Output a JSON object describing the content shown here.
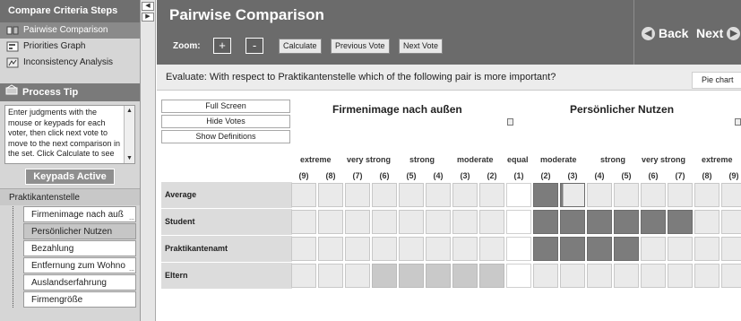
{
  "sidebar": {
    "header": "Compare Criteria Steps",
    "steps": [
      {
        "label": "Pairwise Comparison",
        "icon": "compare-icon",
        "active": true
      },
      {
        "label": "Priorities Graph",
        "icon": "graph-icon",
        "active": false
      },
      {
        "label": "Inconsistency Analysis",
        "icon": "inconsistency-icon",
        "active": false
      }
    ],
    "tip_header": "Process Tip",
    "tip_text": "Enter judgments with the mouse or keypads for each voter, then click next vote to move to the next comparison in the set. Click Calculate to see",
    "keypads_label": "Keypads Active",
    "criteria_root": "Praktikantenstelle",
    "criteria": [
      {
        "label": "Firmenimage nach auß",
        "selected": false,
        "truncated": true
      },
      {
        "label": "Persönlicher Nutzen",
        "selected": true,
        "truncated": false
      },
      {
        "label": "Bezahlung",
        "selected": false,
        "truncated": false
      },
      {
        "label": "Entfernung zum Wohno",
        "selected": false,
        "truncated": true
      },
      {
        "label": "Auslandserfahrung",
        "selected": false,
        "truncated": false
      },
      {
        "label": "Firmengröße",
        "selected": false,
        "truncated": false
      }
    ]
  },
  "header": {
    "title": "Pairwise Comparison",
    "zoom_label": "Zoom:",
    "zoom_in": "+",
    "zoom_out": "-",
    "calculate": "Calculate",
    "previous_vote": "Previous Vote",
    "next_vote": "Next Vote",
    "back": "Back",
    "next": "Next"
  },
  "question": "Evaluate: With respect to Praktikantenstelle which of the following pair is more important?",
  "pie_chart": "Pie chart",
  "options": {
    "full_screen": "Full Screen",
    "hide_votes": "Hide Votes",
    "show_definitions": "Show Definitions"
  },
  "comparison": {
    "left_criterion": "Firmenimage nach außen",
    "right_criterion": "Persönlicher Nutzen"
  },
  "scale": {
    "headers": [
      "extreme",
      "very strong",
      "strong",
      "moderate",
      "equal",
      "moderate",
      "strong",
      "very strong",
      "extreme"
    ],
    "numbers": [
      "(9)",
      "(8)",
      "(7)",
      "(6)",
      "(5)",
      "(4)",
      "(3)",
      "(2)",
      "(1)",
      "(2)",
      "(3)",
      "(4)",
      "(5)",
      "(6)",
      "(7)",
      "(8)",
      "(9)"
    ]
  },
  "voters": [
    {
      "name": "Average",
      "highlight": "right",
      "filled_to": 2,
      "partial": true
    },
    {
      "name": "Student",
      "highlight": "right",
      "filled_to": 6,
      "partial": false
    },
    {
      "name": "Praktikantenamt",
      "highlight": "right",
      "filled_to": 4,
      "partial": false
    },
    {
      "name": "Eltern",
      "highlight": "left",
      "filled_to": 5,
      "partial": false
    }
  ]
}
